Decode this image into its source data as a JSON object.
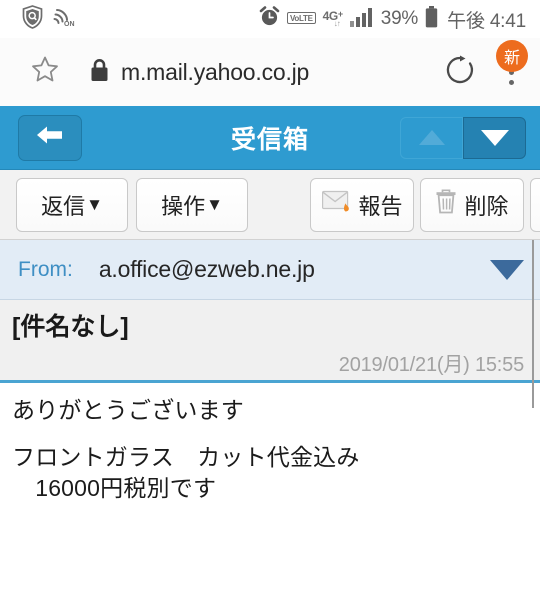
{
  "statusbar": {
    "icons": [
      "shield-scan-icon",
      "nfc-on-icon",
      "alarm-clock-icon",
      "volte-icon",
      "network-4gplus-icon",
      "signal-bars-icon",
      "battery-icon"
    ],
    "volte_label": "VoLTE",
    "network_label": "4G",
    "network_plus": "+",
    "network_arrows": "↓↑",
    "battery_percent": "39%",
    "time": "午後 4:41"
  },
  "browser": {
    "bookmark_icon": "star-icon",
    "security_icon": "lock-icon",
    "url": "m.mail.yahoo.co.jp",
    "reload_icon": "reload-icon",
    "menu_icon": "overflow-menu-icon",
    "menu_badge": "新"
  },
  "header": {
    "back_icon": "back-arrow-icon",
    "title": "受信箱",
    "prev_icon": "triangle-up-icon",
    "next_icon": "triangle-down-icon"
  },
  "toolbar": {
    "reply_label": "返信",
    "reply_caret": "▼",
    "ops_label": "操作",
    "ops_caret": "▼",
    "report_label": "報告",
    "report_icon": "envelope-flame-icon",
    "delete_label": "削除",
    "delete_icon": "trash-icon",
    "extra_label": ""
  },
  "message": {
    "from_label": "From:",
    "from_address": "a.office@ezweb.ne.jp",
    "expand_icon": "triangle-down-icon",
    "subject": "[件名なし]",
    "date": "2019/01/21(月) 15:55",
    "body_lines": [
      "ありがとうございます",
      "フロントガラス　カット代金込み",
      "　16000円税別です"
    ]
  },
  "colors": {
    "header_blue": "#2e9bd0",
    "accent_blue": "#4aa4d2",
    "from_bg": "#e2ecf6",
    "from_label_blue": "#3f8fc4",
    "badge_orange": "#ed6c1e",
    "date_gray": "#a2a2a2"
  }
}
